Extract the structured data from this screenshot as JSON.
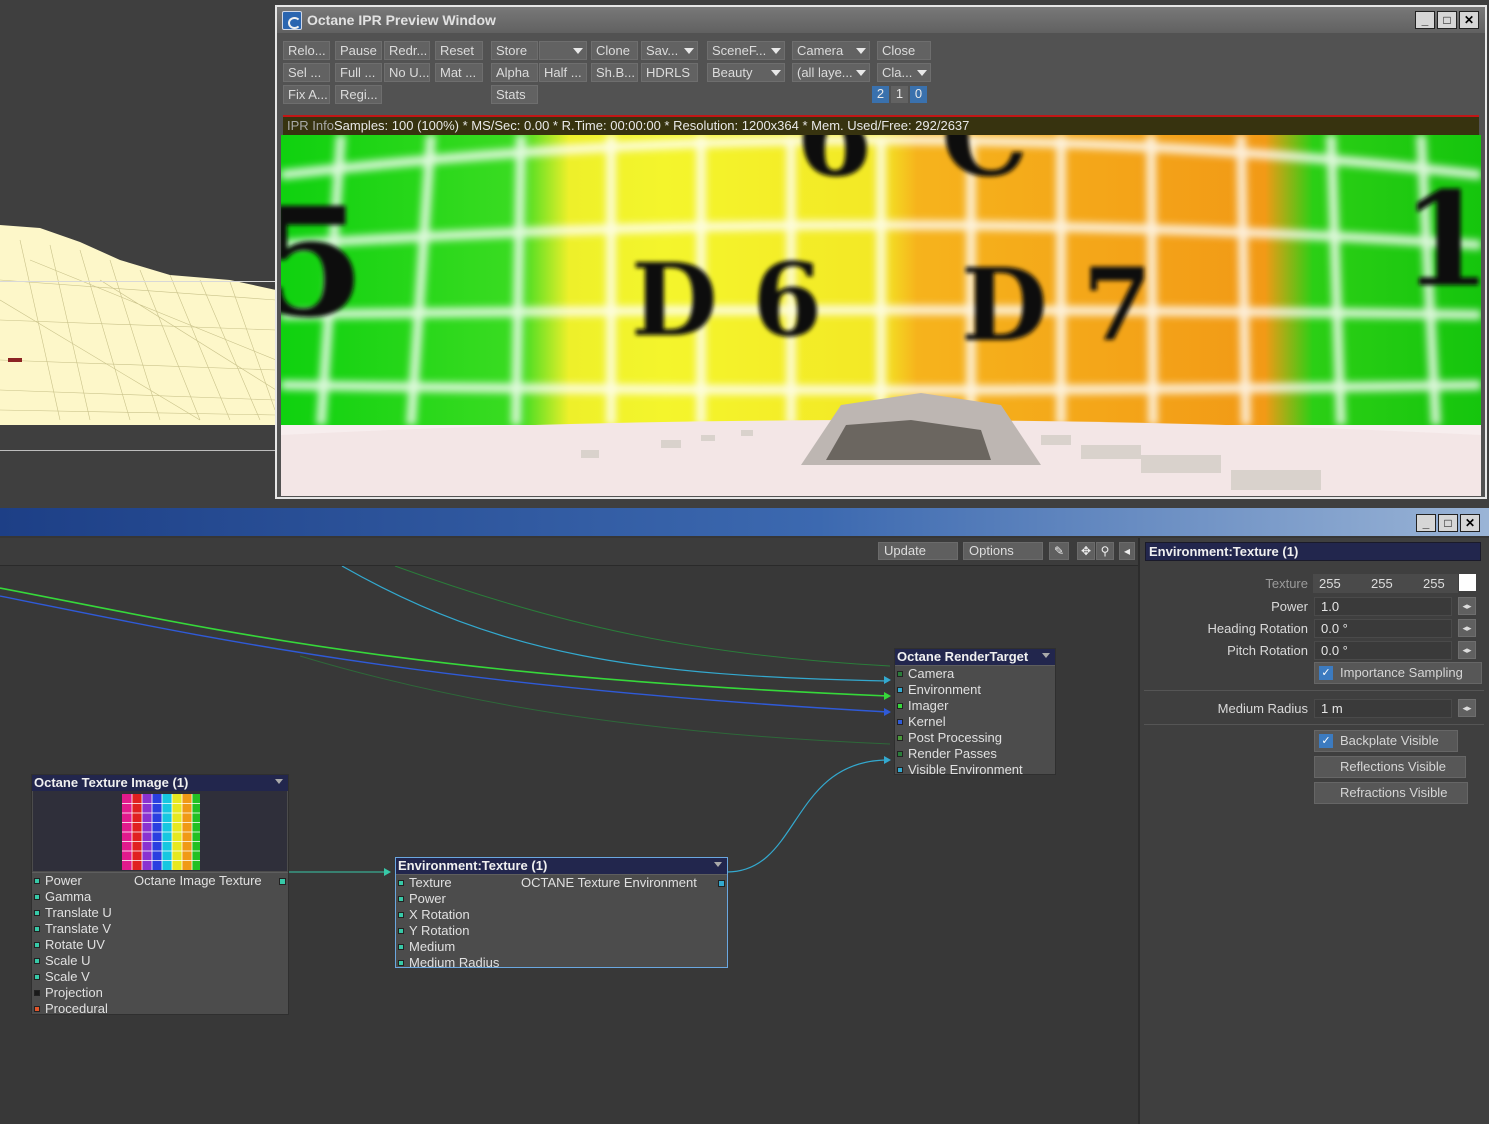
{
  "ipr_window": {
    "title": "Octane IPR Preview Window",
    "controls": {
      "minimize": "_",
      "maximize": "□",
      "close": "✕"
    },
    "toolbar": {
      "row1": [
        "Relo...",
        "Pause",
        "Redr...",
        "Reset",
        "Store",
        "",
        "Clone",
        "Sav...",
        "SceneF...",
        "Camera",
        "Close"
      ],
      "row2": [
        "Sel ...",
        "Full ...",
        "No U...",
        "Mat ...",
        "Alpha",
        "Half ...",
        "Sh.B...",
        "HDRLS",
        "Beauty",
        "(all laye...",
        "Cla..."
      ],
      "row3": [
        "Fix A...",
        "Regi...",
        "Stats"
      ],
      "numbers": [
        "2",
        "1",
        "0"
      ]
    },
    "info": {
      "label": "IPR Info",
      "text": "Samples: 100 (100%)  *  MS/Sec: 0.00  *  R.Time: 00:00:00  *  Resolution: 1200x364  *  Mem. Used/Free: 292/2637"
    },
    "render": {
      "labels": [
        "5",
        "6",
        "C",
        "D 6",
        "D 7",
        "1"
      ]
    }
  },
  "node_editor": {
    "controls": {
      "minimize": "_",
      "maximize": "□",
      "close": "✕"
    },
    "toolbar": {
      "update": "Update",
      "options": "Options",
      "icons": [
        "pen-icon",
        "move-icon",
        "zoom-icon",
        "collapse-left-icon"
      ]
    },
    "nodes": {
      "texture_image": {
        "title": "Octane Texture Image (1)",
        "output": "Octane Image Texture",
        "inputs": [
          "Power",
          "Gamma",
          "Translate U",
          "Translate V",
          "Rotate UV",
          "Scale U",
          "Scale V",
          "Projection",
          "Procedural"
        ]
      },
      "env_texture": {
        "title": "Environment:Texture (1)",
        "output": "OCTANE Texture Environment",
        "inputs": [
          "Texture",
          "Power",
          "X Rotation",
          "Y Rotation",
          "Medium",
          "Medium Radius"
        ]
      },
      "render_target": {
        "title": "Octane RenderTarget",
        "inputs": [
          "Camera",
          "Environment",
          "Imager",
          "Kernel",
          "Post Processing",
          "Render Passes",
          "Visible Environment"
        ]
      }
    },
    "panel": {
      "title": "Environment:Texture (1)",
      "texture_label": "Texture",
      "texture_rgb": [
        "255",
        "255",
        "255"
      ],
      "swatch_color": "#ffffff",
      "power_label": "Power",
      "power_value": "1.0",
      "heading_label": "Heading Rotation",
      "heading_value": "0.0 °",
      "pitch_label": "Pitch Rotation",
      "pitch_value": "0.0 °",
      "importance_sampling": "Importance Sampling",
      "medium_radius_label": "Medium Radius",
      "medium_radius_value": "1 m",
      "backplate_visible": "Backplate Visible",
      "reflections_visible": "Reflections Visible",
      "refractions_visible": "Refractions Visible"
    }
  },
  "colors": {
    "accent": "#3a71ad",
    "node_header": "#22264d",
    "wire_green": "#36d83a",
    "wire_blue": "#2f5ad8",
    "wire_cyan": "#33a9cf"
  }
}
